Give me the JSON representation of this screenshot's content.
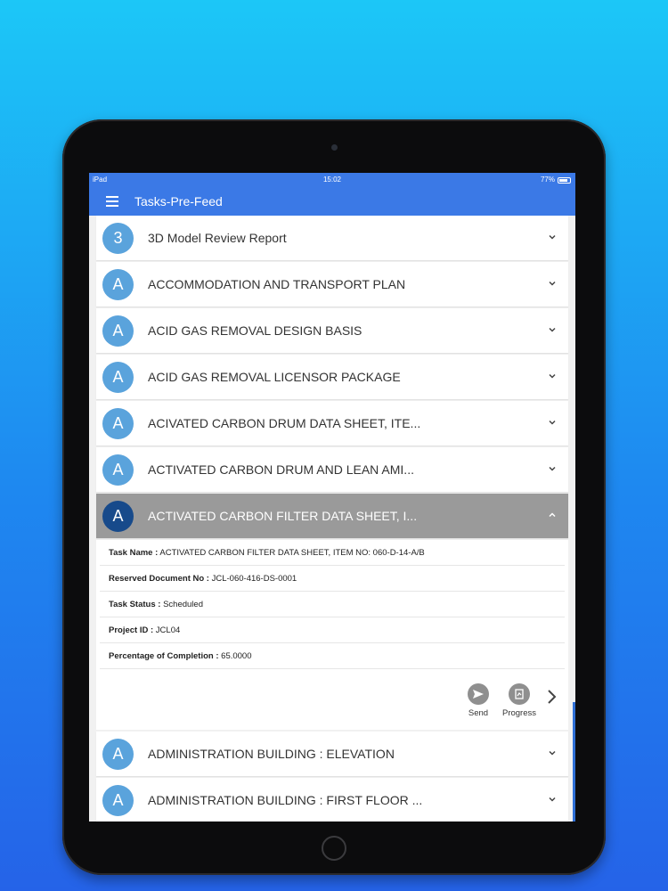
{
  "status_bar": {
    "device": "iPad",
    "time": "15:02",
    "battery": "77%"
  },
  "header": {
    "title": "Tasks-Pre-Feed"
  },
  "list_items": [
    {
      "avatar": "3",
      "title": "3D Model Review Report"
    },
    {
      "avatar": "A",
      "title": "ACCOMMODATION AND TRANSPORT PLAN"
    },
    {
      "avatar": "A",
      "title": "ACID GAS REMOVAL DESIGN BASIS"
    },
    {
      "avatar": "A",
      "title": "ACID GAS REMOVAL LICENSOR PACKAGE"
    },
    {
      "avatar": "A",
      "title": "ACIVATED CARBON DRUM DATA SHEET, ITE..."
    },
    {
      "avatar": "A",
      "title": "ACTIVATED CARBON DRUM AND LEAN AMI..."
    },
    {
      "avatar": "A",
      "title": "ACTIVATED CARBON FILTER DATA SHEET, I..."
    },
    {
      "avatar": "A",
      "title": "ADMINISTRATION BUILDING : ELEVATION"
    },
    {
      "avatar": "A",
      "title": "ADMINISTRATION BUILDING : FIRST FLOOR ..."
    }
  ],
  "details": {
    "task_name_label": "Task Name :",
    "task_name": "ACTIVATED CARBON FILTER DATA SHEET, ITEM NO: 060-D-14-A/B",
    "reserved_doc_label": "Reserved Document No :",
    "reserved_doc": "JCL-060-416-DS-0001",
    "task_status_label": "Task Status :",
    "task_status": "Scheduled",
    "project_id_label": "Project ID :",
    "project_id": "JCL04",
    "completion_label": "Percentage of Completion :",
    "completion": "65.0000"
  },
  "actions": {
    "send": "Send",
    "progress": "Progress"
  },
  "colors": {
    "app_bar": "#3b79e6",
    "avatar": "#5aa3dc",
    "avatar_active": "#174a8b",
    "expanded_header": "#9a9a9a"
  }
}
